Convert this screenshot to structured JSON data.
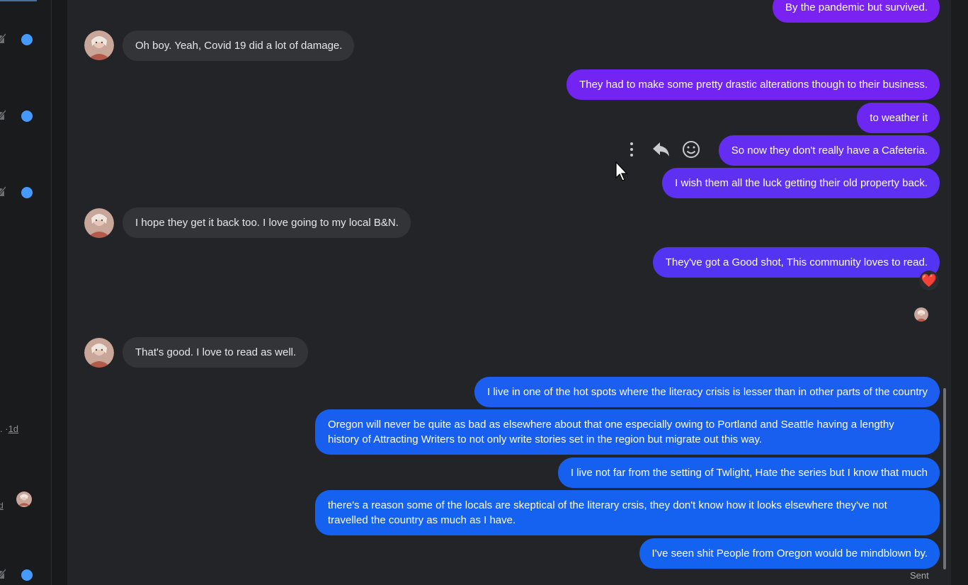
{
  "sidebar": {
    "time_prefix": ". ·",
    "time_value": "1d",
    "truncated_text": "d",
    "unread_color": "#4599ff"
  },
  "messages": [
    {
      "dir": "out",
      "text": "By the pandemic but survived."
    },
    {
      "dir": "in",
      "text": "Oh boy. Yeah, Covid 19 did a lot of damage."
    },
    {
      "dir": "out",
      "text": "They had to make some pretty drastic alterations though to their business."
    },
    {
      "dir": "out",
      "text": "to weather it"
    },
    {
      "dir": "out",
      "text": "So now they don't really have a Cafeteria."
    },
    {
      "dir": "out",
      "text": "I wish them all the luck getting their old property back."
    },
    {
      "dir": "in",
      "text": "I hope they get it back too. I love going to my local B&N."
    },
    {
      "dir": "out",
      "text": "They've got a Good shot, This community loves to read.",
      "reaction": "heart"
    },
    {
      "dir": "in",
      "text": "That's good. I love to read as well."
    },
    {
      "dir": "out",
      "text": "I live in one of the hot spots where the literacy crisis is lesser than in other parts of the country"
    },
    {
      "dir": "out",
      "text": "Oregon will never be quite as bad as elsewhere about that one especially owing to Portland and Seattle having a lengthy history of Attracting Writers to  not only write stories set in the region but migrate out this way."
    },
    {
      "dir": "out",
      "text": "I live not far from the setting of Twlight, Hate the series but I know that much"
    },
    {
      "dir": "out",
      "text": "there's a reason some of the locals are skeptical of the literary crsis, they don't know how it looks elsewhere they've not travelled the country as much as I have."
    },
    {
      "dir": "out",
      "text": "I've seen shit People from Oregon would be mindblown by."
    }
  ],
  "reaction_emoji": "❤️",
  "status": {
    "sent_label": "Sent"
  },
  "message_actions": [
    "more-options-icon",
    "reply-icon",
    "react-icon"
  ],
  "colors": {
    "bubble_purple": "#7a22f2",
    "bubble_mid": "#5a35f2",
    "bubble_blue": "#1560f0",
    "incoming": "#333437"
  }
}
